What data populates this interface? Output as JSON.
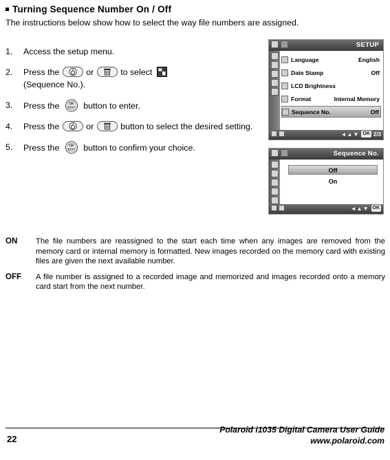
{
  "heading": "Turning Sequence Number On / Off",
  "intro": "The instructions below show how to select the way file numbers are assigned.",
  "steps": [
    {
      "num": "1.",
      "text": "Access the setup menu."
    },
    {
      "num": "2.",
      "pre": "Press the",
      "mid": "or",
      "post": "to select",
      "after": "(Sequence No.)."
    },
    {
      "num": "3.",
      "pre": "Press the",
      "post": "button to enter."
    },
    {
      "num": "4.",
      "pre": "Press the",
      "mid": "or",
      "post": "button to select the desired setting."
    },
    {
      "num": "5.",
      "pre": "Press the",
      "post": "button to confirm your choice."
    }
  ],
  "okbutton": {
    "line1": "OK",
    "line2": "EDIT"
  },
  "lcd_setup": {
    "title": "SETUP",
    "rows": [
      {
        "label": "Language",
        "value": "English",
        "selected": false
      },
      {
        "label": "Date Stamp",
        "value": "Off",
        "selected": false
      },
      {
        "label": "LCD Brightness",
        "value": "",
        "selected": false
      },
      {
        "label": "Format",
        "value": "Internal Memory",
        "selected": false
      },
      {
        "label": "Sequence No.",
        "value": "Off",
        "selected": true
      }
    ],
    "ok_badge": "OK",
    "page": "2/3",
    "arrows": "◄▲▼"
  },
  "lcd_seq": {
    "title": "Sequence No.",
    "options": [
      {
        "label": "Off",
        "selected": true
      },
      {
        "label": "On",
        "selected": false
      }
    ],
    "ok_badge": "OK",
    "arrows": "◄▲▼"
  },
  "definitions": [
    {
      "term": "ON",
      "text": "The file numbers are reassigned to the start each time when any images are removed from the memory card or internal memory is formatted. New images recorded on the memory card with existing files are given the next available number."
    },
    {
      "term": "OFF",
      "text": "A file number is assigned to a recorded image and memorized and images recorded onto a memory card start from the next number."
    }
  ],
  "footer": {
    "page_number": "22",
    "guide": "Polaroid i1035 Digital Camera User Guide",
    "url": "www.polaroid.com"
  }
}
